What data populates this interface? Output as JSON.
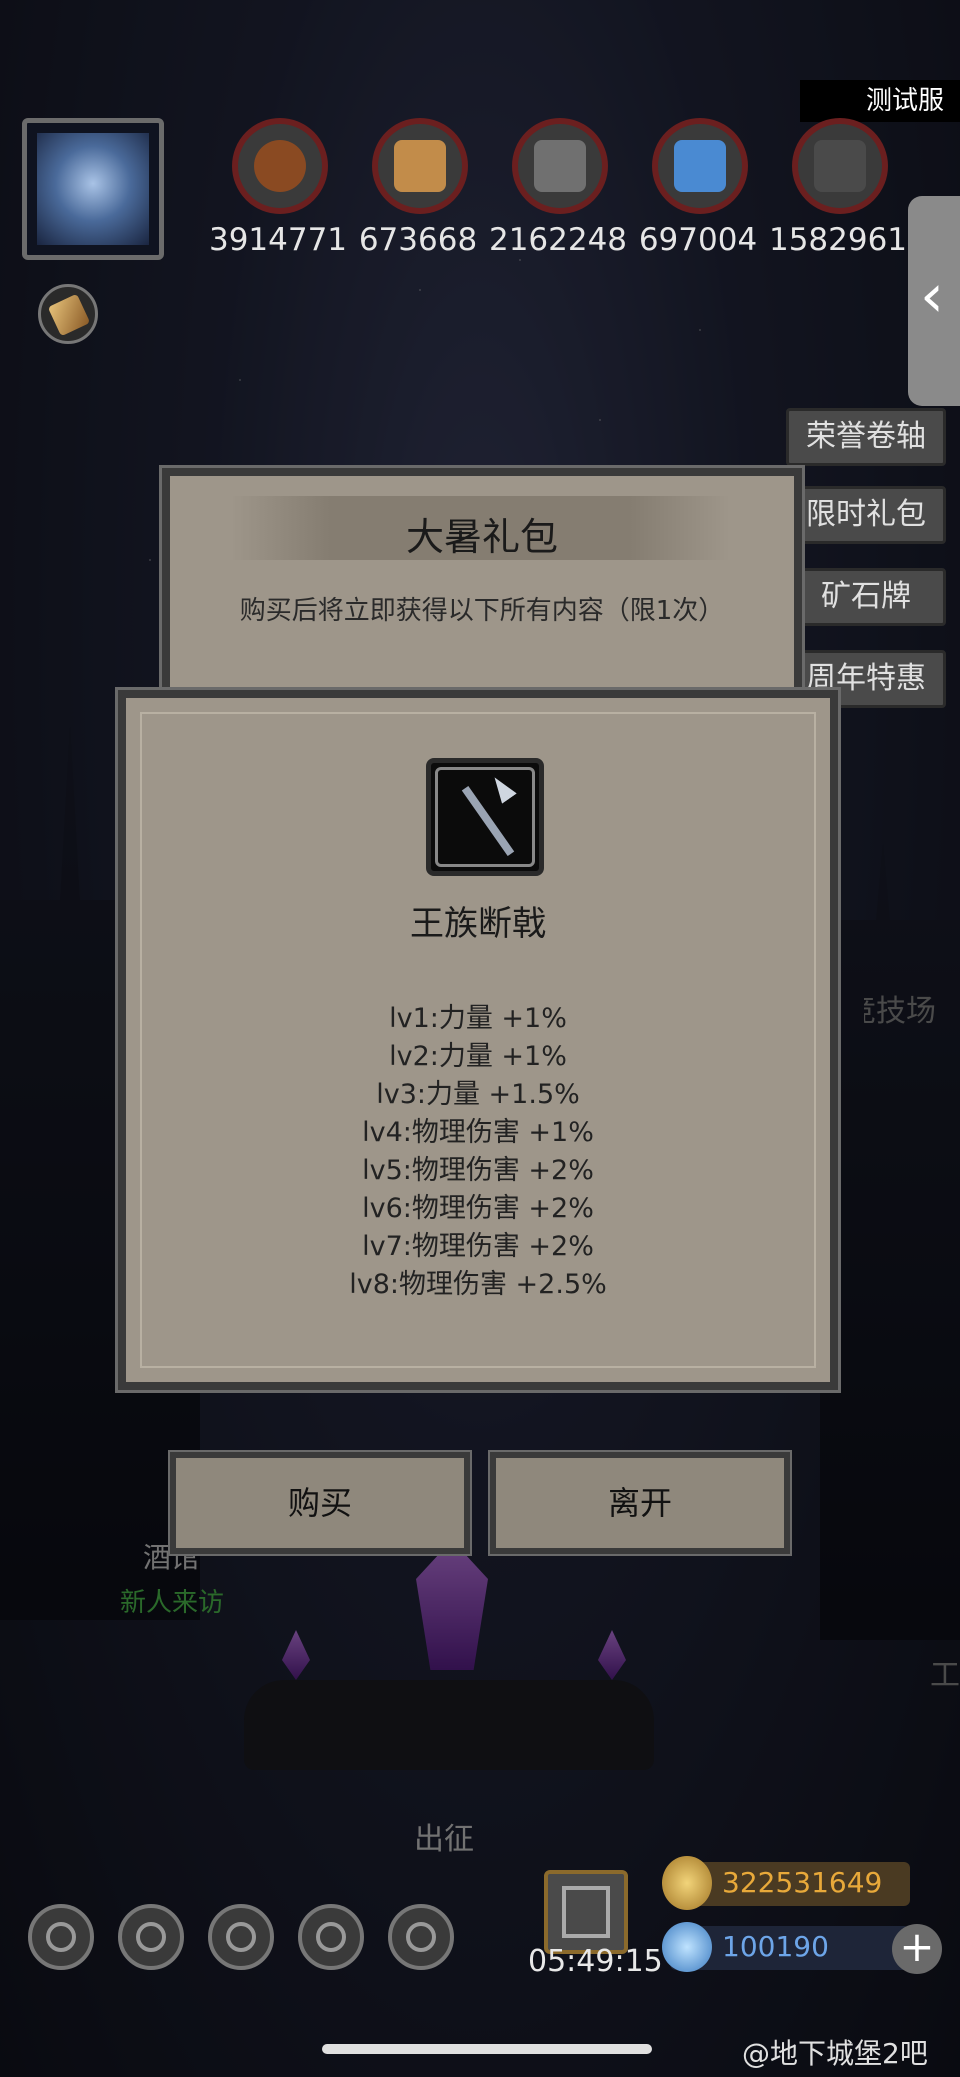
{
  "header": {
    "server_label": "测试服",
    "resources": [
      {
        "icon": "meat-icon",
        "value": "3914771",
        "color": "#8a4a22"
      },
      {
        "icon": "wood-icon",
        "value": "673668",
        "color": "#c28c4a"
      },
      {
        "icon": "iron-icon",
        "value": "2162248",
        "color": "#707070"
      },
      {
        "icon": "crystal-icon",
        "value": "697004",
        "color": "#4a8ad2"
      },
      {
        "icon": "stone-icon",
        "value": "1582961",
        "color": "#4a4a4a"
      }
    ]
  },
  "side_menu": [
    "荣誉卷轴",
    "限时礼包",
    "矿石牌",
    "周年特惠"
  ],
  "popup": {
    "title": "大暑礼包",
    "description": "购买后将立即获得以下所有内容（限1次）",
    "item_name": "王族断戟",
    "stats": [
      "lv1:力量 +1%",
      "lv2:力量 +1%",
      "lv3:力量 +1.5%",
      "lv4:物理伤害 +1%",
      "lv5:物理伤害 +2%",
      "lv6:物理伤害 +2%",
      "lv7:物理伤害 +2%",
      "lv8:物理伤害 +2.5%"
    ],
    "buy_label": "购买",
    "leave_label": "离开"
  },
  "scene": {
    "tavern": "酒馆",
    "tavern_status": "新人来访",
    "expedition": "出征",
    "arena": "竞技场",
    "work": "工"
  },
  "footer": {
    "timer": "05:49:15",
    "gold": "322531649",
    "gems": "100190",
    "plus": "+",
    "watermark": "@地下城堡2吧"
  }
}
